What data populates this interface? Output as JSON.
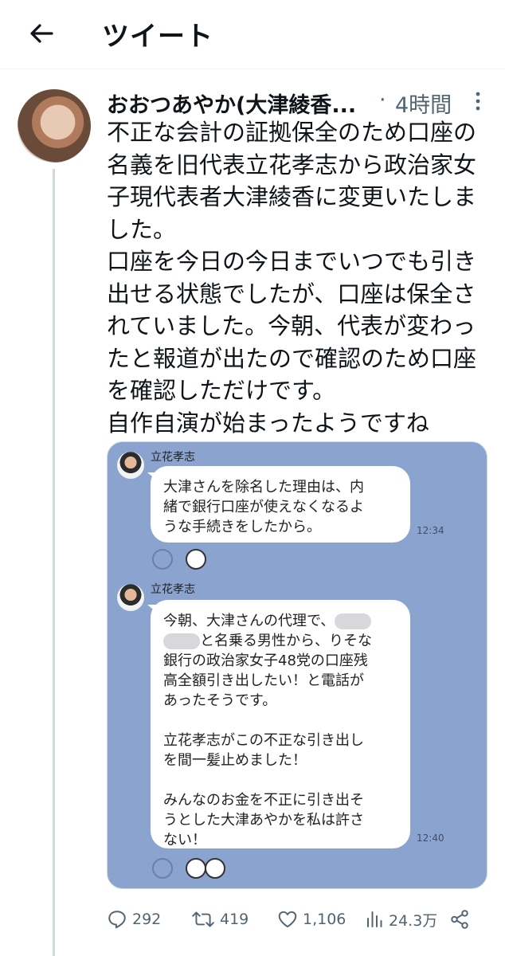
{
  "header": {
    "title": "ツイート"
  },
  "tweet": {
    "author_name": "おおつあやか(大津綾香...",
    "dot": "·",
    "time": "4時間",
    "body_lines": [
      "不正な会計の証拠保全のため口座の",
      "名義を旧代表立花孝志から政治家女",
      "子現代表者大津綾香に変更いたしま",
      "した。",
      "口座を今日の今日までいつでも引き",
      "出せる状態でしたが、口座は保全さ",
      "れていました。今朝、代表が変わっ",
      "たと報道が出たので確認のため口座",
      "を確認しただけです。",
      "自作自演が始まったようですね"
    ]
  },
  "media": {
    "messages": [
      {
        "sender": "立花孝志",
        "lines": [
          "大津さんを除名した理由は、内",
          "緒で銀行口座が使えなくなるよ",
          "うな手続きをしたから。"
        ],
        "time": "12:34"
      },
      {
        "sender": "立花孝志",
        "line1": "今朝、大津さんの代理で、",
        "line2": "と名乗る男性から、りそな",
        "lines": [
          "銀行の政治家女子48党の口座残",
          "高全額引き出したい！と電話が",
          "あったそうです。",
          "",
          "立花孝志がこの不正な引き出し",
          "を間一髪止めました！",
          "",
          "みんなのお金を不正に引き出そ",
          "うとした大津あやかを私は許さ",
          "ない！"
        ],
        "time": "12:40"
      }
    ]
  },
  "actions": {
    "replies": "292",
    "retweets": "419",
    "likes": "1,106",
    "views": "24.3万"
  }
}
